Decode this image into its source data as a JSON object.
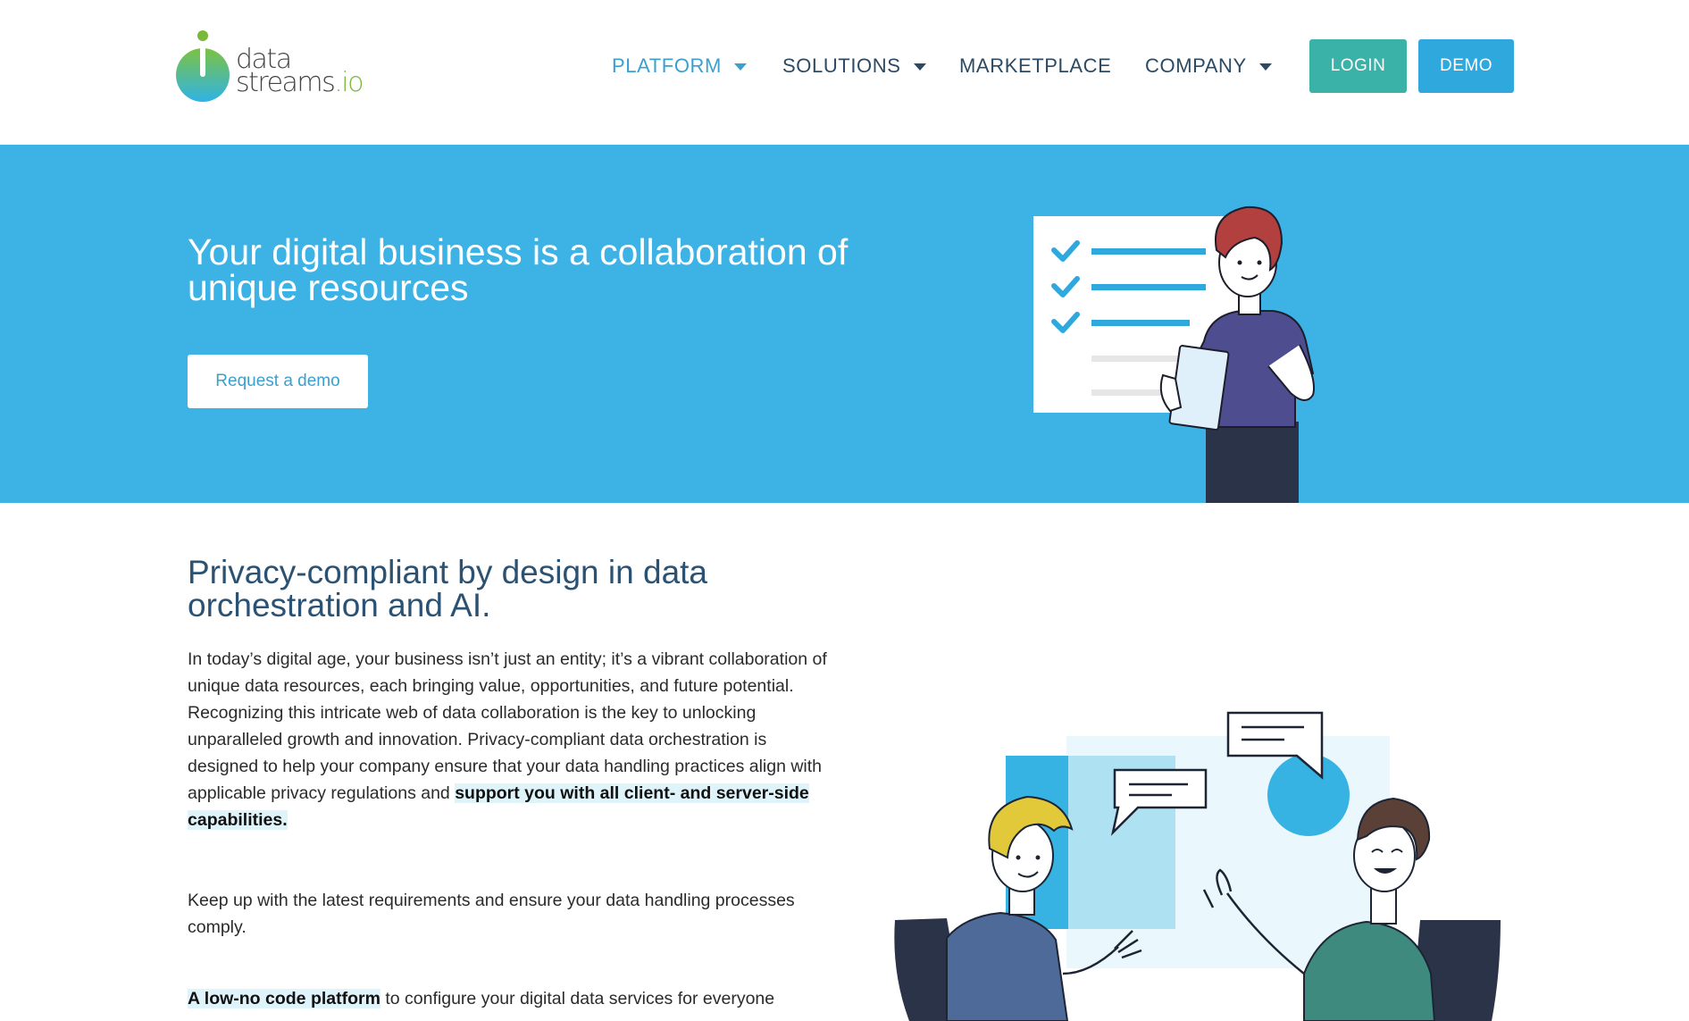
{
  "brand": {
    "logo_line1": "data",
    "logo_line2_main": "streams",
    "logo_line2_suffix": ".io",
    "accent_blue": "#3cb2e5",
    "accent_teal": "#3bb2a8",
    "logo_green": "#7ab83a"
  },
  "nav": {
    "items": [
      {
        "label": "PLATFORM",
        "has_dropdown": true,
        "active": true
      },
      {
        "label": "SOLUTIONS",
        "has_dropdown": true,
        "active": false
      },
      {
        "label": "MARKETPLACE",
        "has_dropdown": false,
        "active": false
      },
      {
        "label": "COMPANY",
        "has_dropdown": true,
        "active": false
      }
    ],
    "login_label": "LOGIN",
    "demo_label": "DEMO"
  },
  "hero": {
    "title": "Your digital business is a collaboration of unique resources",
    "cta_label": "Request a demo"
  },
  "content": {
    "title": "Privacy-compliant by design in data orchestration and AI.",
    "p1_text": "In today’s digital age, your business isn’t just an entity; it’s a vibrant collaboration of unique data resources, each bringing value, opportunities, and future potential. Recognizing this intricate web of data collaboration is the key to unlocking unparalleled growth and innovation. Privacy-compliant data orchestration is designed to help your company ensure that your data handling practices align with applicable privacy regulations and ",
    "p1_highlight": "support you with all client- and server-side capabilities.",
    "p2_text": "Keep up with the latest requirements and ensure your data handling processes comply.",
    "p3_highlight": "A low-no code platform",
    "p3_text": " to configure your digital data services for everyone"
  }
}
